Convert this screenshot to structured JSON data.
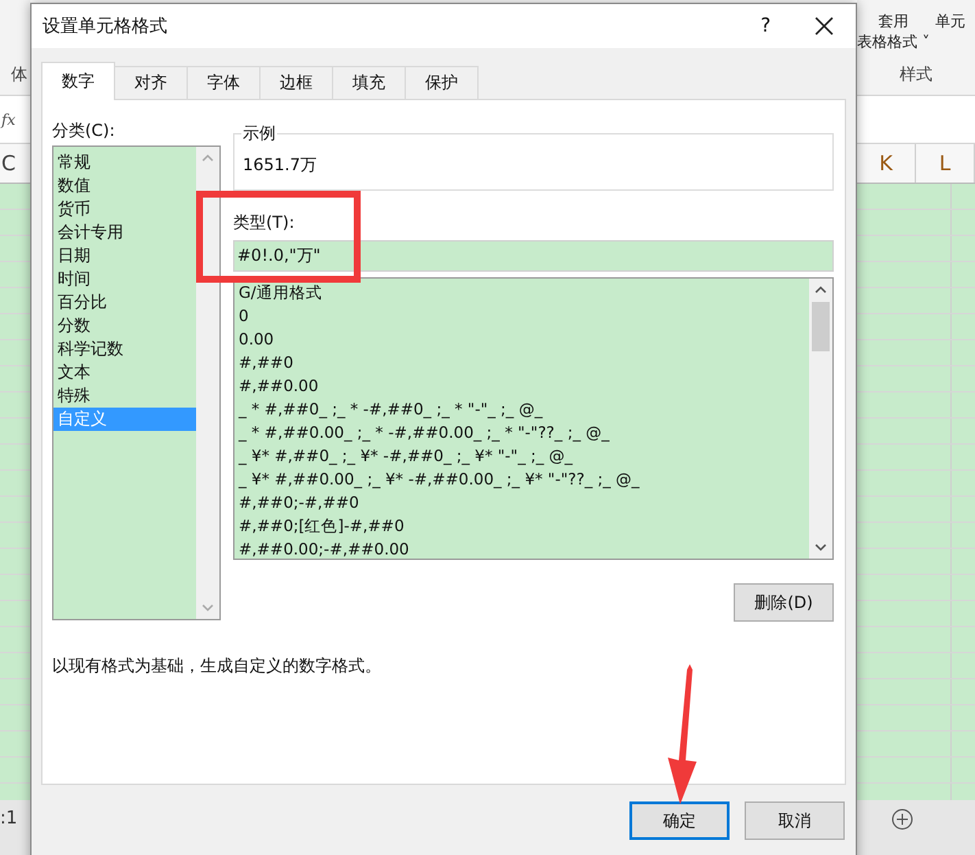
{
  "excel": {
    "ribbon_left_label": "体",
    "formula_label": "fx",
    "left_column": "C",
    "right_columns": [
      "K",
      "L"
    ],
    "ribbon_buttons": [
      {
        "line1": "套用",
        "line2": "表格格式",
        "caret": "˅"
      },
      {
        "line1": "单元"
      }
    ],
    "ribbon_group": "样式",
    "status_left": ":1"
  },
  "dialog": {
    "title": "设置单元格格式",
    "help": "?",
    "tabs": [
      {
        "label": "数字",
        "selected": true
      },
      {
        "label": "对齐",
        "selected": false
      },
      {
        "label": "字体",
        "selected": false
      },
      {
        "label": "边框",
        "selected": false
      },
      {
        "label": "填充",
        "selected": false
      },
      {
        "label": "保护",
        "selected": false
      }
    ],
    "category_label": "分类(C):",
    "categories": [
      {
        "label": "常规",
        "selected": false
      },
      {
        "label": "数值",
        "selected": false
      },
      {
        "label": "货币",
        "selected": false
      },
      {
        "label": "会计专用",
        "selected": false
      },
      {
        "label": "日期",
        "selected": false
      },
      {
        "label": "时间",
        "selected": false
      },
      {
        "label": "百分比",
        "selected": false
      },
      {
        "label": "分数",
        "selected": false
      },
      {
        "label": "科学记数",
        "selected": false
      },
      {
        "label": "文本",
        "selected": false
      },
      {
        "label": "特殊",
        "selected": false
      },
      {
        "label": "自定义",
        "selected": true
      }
    ],
    "sample_label": "示例",
    "sample_value": "1651.7万",
    "type_label": "类型(T):",
    "type_value": "#0!.0,\"万\"",
    "formats": [
      "G/通用格式",
      "0",
      "0.00",
      "#,##0",
      "#,##0.00",
      "_ * #,##0_ ;_ * -#,##0_ ;_ * \"-\"_ ;_ @_",
      "_ * #,##0.00_ ;_ * -#,##0.00_ ;_ * \"-\"??_ ;_ @_",
      "_ ¥* #,##0_ ;_ ¥* -#,##0_ ;_ ¥* \"-\"_ ;_ @_",
      "_ ¥* #,##0.00_ ;_ ¥* -#,##0.00_ ;_ ¥* \"-\"??_ ;_ @_",
      "#,##0;-#,##0",
      "#,##0;[红色]-#,##0",
      "#,##0.00;-#,##0.00"
    ],
    "delete_button": "删除(D)",
    "description": "以现有格式为基础，生成自定义的数字格式。",
    "buttons": [
      {
        "label": "确定",
        "kind": "primary"
      },
      {
        "label": "取消",
        "kind": "normal"
      }
    ]
  }
}
